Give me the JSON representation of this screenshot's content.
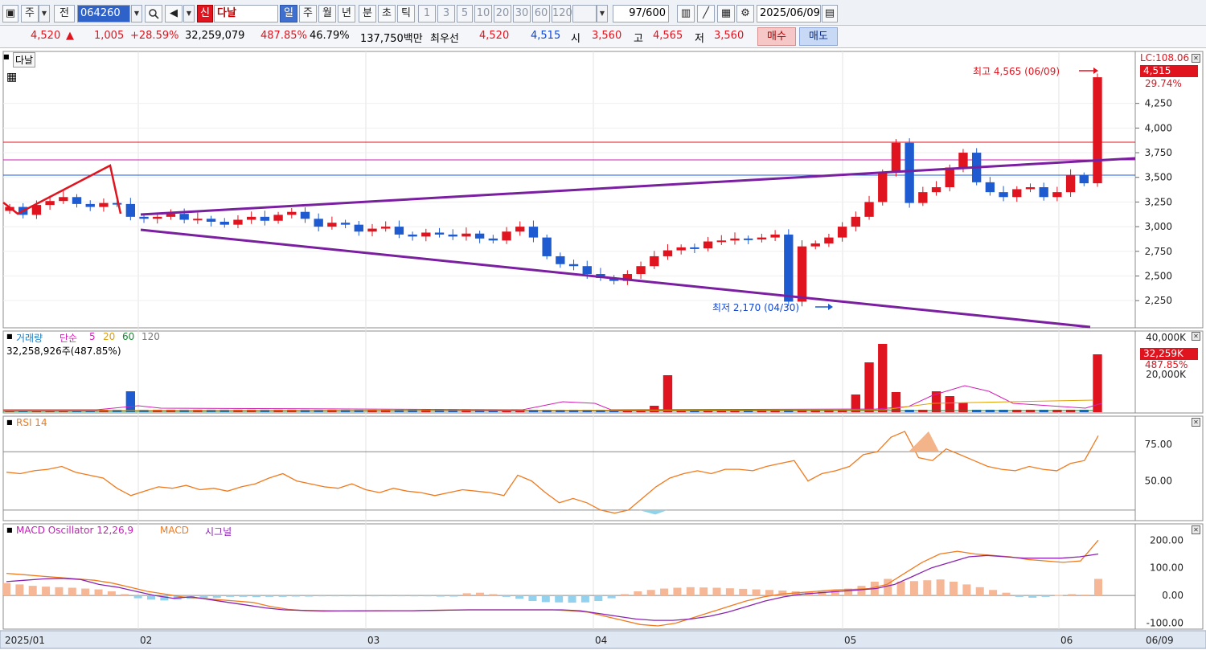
{
  "toolbar": {
    "market": "주",
    "prev": "전",
    "code": "064260",
    "new_badge": "신",
    "stock_name": "다날",
    "periods": [
      "일",
      "주",
      "월",
      "년",
      "분",
      "초",
      "틱"
    ],
    "active_period": "일",
    "minutes": [
      "1",
      "3",
      "5",
      "10",
      "20",
      "30",
      "60",
      "120"
    ],
    "count": "97",
    "count_total": "/600",
    "date": "2025/06/09"
  },
  "quote": {
    "price": "4,520",
    "change_arrow": "▲",
    "change": "1,005",
    "change_pct": "+28.59%",
    "volume": "32,259,079",
    "volume_pct": "487.85%",
    "turnover": "46.79%",
    "amount": "137,750백만",
    "best_ask_label": "최우선",
    "best_ask": "4,520",
    "best_bid": "4,515",
    "open_label": "시",
    "open": "3,560",
    "high_label": "고",
    "high": "4,565",
    "low_label": "저",
    "low": "3,560",
    "buy": "매수",
    "sell": "매도"
  },
  "chart": {
    "title": "다날",
    "lc": "LC:108.06",
    "last_price": "4,515",
    "last_pct": "29.74%",
    "high_annotation": "최고 4,565 (06/09)",
    "low_annotation": "최저 2,170 (04/30)",
    "x_labels": [
      "2025/01",
      "02",
      "03",
      "04",
      "05",
      "06",
      "06/09"
    ],
    "price_ticks": [
      "4,250",
      "4,000",
      "3,750",
      "3,500",
      "3,250",
      "3,000",
      "2,750",
      "2,500",
      "2,250"
    ],
    "volume_panel": {
      "title": "거래량",
      "ma_label": "단순",
      "ma": [
        "5",
        "20",
        "60",
        "120"
      ],
      "value": "32,258,926주(487.85%)",
      "ticks": [
        "40,000K",
        "20,000K"
      ],
      "last": "32,259K",
      "last_pct": "487.85%"
    },
    "rsi_panel": {
      "title": "RSI 14",
      "ticks": [
        "75.00",
        "50.00"
      ]
    },
    "macd_panel": {
      "title": "MACD Oscillator 12,26,9",
      "macd": "MACD",
      "signal": "시그널",
      "ticks": [
        "200.00",
        "100.00",
        "0.00",
        "-100.00"
      ]
    },
    "colors": {
      "up": "#e0141e",
      "down": "#1f5bd0",
      "trend": "#7a1fa0",
      "rsi": "#f07a1e"
    }
  },
  "chart_data": {
    "type": "candlestick",
    "x_range": [
      "2025/01",
      "2025/06/09"
    ],
    "ylim": [
      2170,
      4565
    ],
    "y_ticks": [
      2250,
      2500,
      2750,
      3000,
      3250,
      3500,
      3750,
      4000,
      4250
    ],
    "series": [
      {
        "name": "가격",
        "values": [
          3200,
          3120,
          3220,
          3260,
          3300,
          3230,
          3200,
          3240,
          3230,
          3100,
          3080,
          3100,
          3130,
          3070,
          3080,
          3050,
          3020,
          3070,
          3100,
          3060,
          3120,
          3150,
          3080,
          3000,
          3040,
          3020,
          2950,
          2980,
          3000,
          2920,
          2900,
          2940,
          2920,
          2900,
          2930,
          2880,
          2860,
          2950,
          3000,
          2890,
          2700,
          2620,
          2600,
          2520,
          2480,
          2450,
          2520,
          2600,
          2700,
          2760,
          2790,
          2780,
          2850,
          2860,
          2880,
          2870,
          2890,
          2920,
          2240,
          2800,
          2830,
          2890,
          3000,
          3100,
          3250,
          3550,
          3850,
          3240,
          3350,
          3400,
          3600,
          3750,
          3450,
          3350,
          3300,
          3380,
          3400,
          3300,
          3350,
          3520,
          3440,
          4515
        ]
      },
      {
        "name": "RSI 14",
        "values": [
          56,
          55,
          57,
          58,
          60,
          56,
          54,
          52,
          45,
          40,
          43,
          46,
          45,
          47,
          44,
          45,
          43,
          46,
          48,
          52,
          55,
          50,
          48,
          46,
          45,
          48,
          44,
          42,
          45,
          43,
          42,
          40,
          42,
          44,
          43,
          42,
          40,
          54,
          50,
          42,
          35,
          38,
          35,
          30,
          28,
          30,
          38,
          46,
          52,
          55,
          57,
          55,
          58,
          58,
          57,
          60,
          62,
          64,
          50,
          55,
          57,
          60,
          68,
          70,
          80,
          84,
          66,
          64,
          72,
          68,
          64,
          60,
          58,
          57,
          60,
          58,
          57,
          62,
          64,
          81
        ]
      },
      {
        "name": "MACD Oscillator",
        "values": [
          45,
          40,
          35,
          32,
          30,
          28,
          25,
          22,
          15,
          5,
          -10,
          -15,
          -18,
          -15,
          -12,
          -10,
          -8,
          -5,
          -5,
          -6,
          -5,
          -5,
          -4,
          -4,
          -3,
          -3,
          -3,
          -3,
          -3,
          -2,
          -2,
          -3,
          -3,
          -4,
          -4,
          8,
          10,
          5,
          -5,
          -12,
          -20,
          -24,
          -25,
          -26,
          -25,
          -20,
          -10,
          5,
          15,
          20,
          25,
          28,
          30,
          29,
          28,
          26,
          24,
          22,
          20,
          18,
          15,
          12,
          14,
          18,
          25,
          35,
          50,
          60,
          50,
          52,
          55,
          58,
          50,
          40,
          30,
          20,
          10,
          -5,
          -8,
          -5,
          2,
          5,
          3,
          60
        ]
      },
      {
        "name": "MACD",
        "values": [
          80,
          75,
          70,
          65,
          60,
          55,
          45,
          30,
          15,
          5,
          -5,
          -10,
          -15,
          -20,
          -25,
          -40,
          -50,
          -55,
          -57,
          -56,
          -55,
          -56,
          -55,
          -55,
          -54,
          -53,
          -52,
          -52,
          -52,
          -52,
          -52,
          -52,
          -55,
          -60,
          -75,
          -90,
          -105,
          -110,
          -100,
          -80,
          -60,
          -40,
          -20,
          -5,
          5,
          10,
          15,
          20,
          22,
          25,
          40,
          80,
          120,
          150,
          160,
          150,
          145,
          140,
          130,
          125,
          120,
          125,
          200
        ]
      },
      {
        "name": "시그널",
        "values": [
          50,
          55,
          60,
          62,
          58,
          40,
          30,
          15,
          0,
          -10,
          -5,
          -15,
          -25,
          -35,
          -45,
          -52,
          -54,
          -55,
          -56,
          -56,
          -55,
          -55,
          -55,
          -54,
          -53,
          -52,
          -52,
          -52,
          -52,
          -52,
          -52,
          -55,
          -65,
          -75,
          -85,
          -90,
          -90,
          -85,
          -75,
          -60,
          -40,
          -20,
          -5,
          5,
          10,
          15,
          20,
          25,
          40,
          70,
          100,
          120,
          140,
          145,
          140,
          135,
          135,
          135,
          140,
          150
        ]
      }
    ]
  }
}
